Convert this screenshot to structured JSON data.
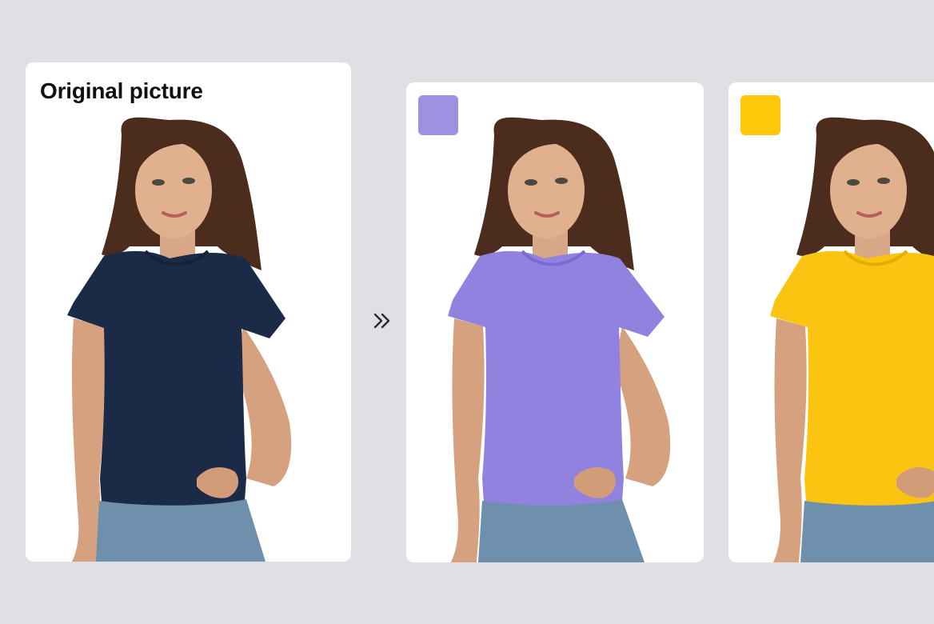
{
  "original_card": {
    "title": "Original picture",
    "shirt_color": "#1b2a46"
  },
  "variants": [
    {
      "name": "purple",
      "swatch_color": "#9f90e2",
      "shirt_color": "#9082de"
    },
    {
      "name": "yellow",
      "swatch_color": "#fdc80a",
      "shirt_color": "#fbc411"
    }
  ],
  "icons": {
    "arrow": "double-chevron-right-icon"
  },
  "colors": {
    "background": "#dfe0e4",
    "card": "#ffffff",
    "hair": "#4b2c1d",
    "skin": "#d8a787",
    "jeans": "#6f90ad"
  }
}
